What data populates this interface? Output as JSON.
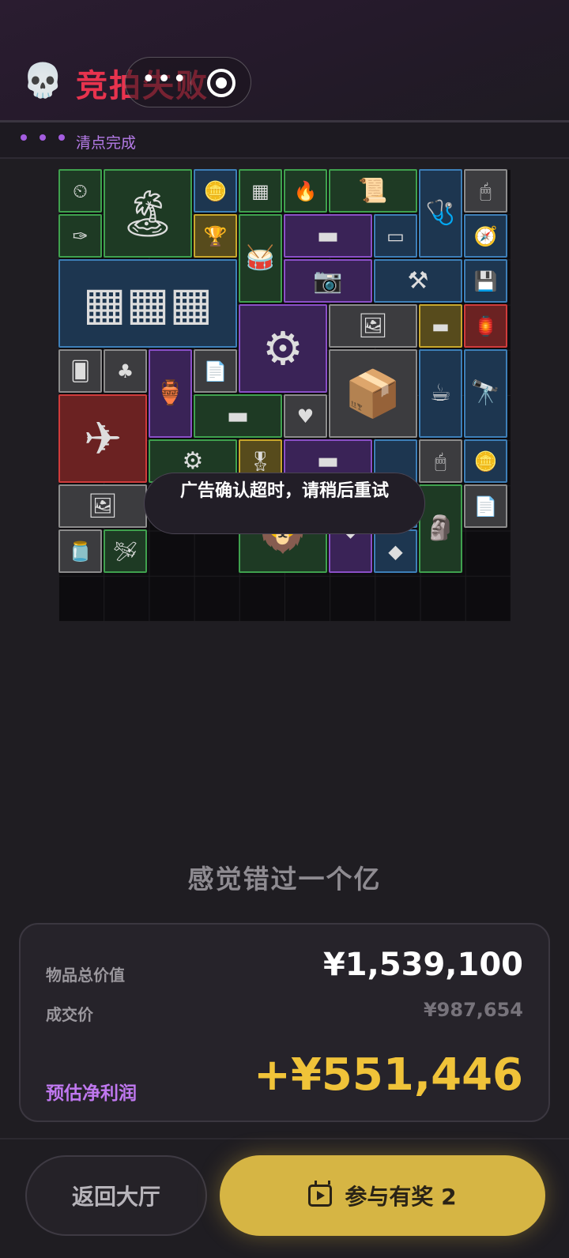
{
  "header": {
    "status_title": "竞拍失败",
    "skull_icon": "skull-icon",
    "menu_icon": "more-dots-icon",
    "close_icon": "target-circle-icon"
  },
  "progress": {
    "text": "清点完成"
  },
  "inventory": {
    "rarity_colors": {
      "green": "#3fa14e",
      "blue": "#3d7fb8",
      "purple": "#8a4fc7",
      "gold": "#c8a72c",
      "red": "#d03b3b",
      "gray": "#8c8c8c"
    },
    "items": [
      {
        "name": "gauge-icon",
        "rarity": "green"
      },
      {
        "name": "painting-icon",
        "rarity": "green"
      },
      {
        "name": "coin-icon",
        "rarity": "blue"
      },
      {
        "name": "circuit-board-icon",
        "rarity": "green"
      },
      {
        "name": "lighter-icon",
        "rarity": "green"
      },
      {
        "name": "document-icon",
        "rarity": "green"
      },
      {
        "name": "stethoscope-icon",
        "rarity": "blue"
      },
      {
        "name": "mouse-icon",
        "rarity": "gray"
      },
      {
        "name": "tweezers-icon",
        "rarity": "green"
      },
      {
        "name": "trophy-icon",
        "rarity": "gold"
      },
      {
        "name": "drum-icon",
        "rarity": "green"
      },
      {
        "name": "graphics-card-icon",
        "rarity": "purple"
      },
      {
        "name": "ssd-icon",
        "rarity": "blue"
      },
      {
        "name": "compass-icon",
        "rarity": "blue"
      },
      {
        "name": "solar-panel-icon",
        "rarity": "blue"
      },
      {
        "name": "camera-lens-icon",
        "rarity": "purple"
      },
      {
        "name": "rifle-icon",
        "rarity": "blue"
      },
      {
        "name": "card-reader-icon",
        "rarity": "blue"
      },
      {
        "name": "circular-saw-icon",
        "rarity": "purple"
      },
      {
        "name": "old-photo-icon",
        "rarity": "gray"
      },
      {
        "name": "ram-stick-icon",
        "rarity": "gold"
      },
      {
        "name": "lamp-icon",
        "rarity": "red"
      },
      {
        "name": "playing-card-icon",
        "rarity": "gray"
      },
      {
        "name": "playing-card-icon",
        "rarity": "gray"
      },
      {
        "name": "hookah-icon",
        "rarity": "purple"
      },
      {
        "name": "papers-icon",
        "rarity": "gray"
      },
      {
        "name": "candle-box-icon",
        "rarity": "gray"
      },
      {
        "name": "coffee-pot-icon",
        "rarity": "blue"
      },
      {
        "name": "telescope-icon",
        "rarity": "blue"
      },
      {
        "name": "drone-icon",
        "rarity": "red"
      },
      {
        "name": "wood-plank-icon",
        "rarity": "green"
      },
      {
        "name": "playing-card-icon",
        "rarity": "gray"
      },
      {
        "name": "metal-part-icon",
        "rarity": "green"
      },
      {
        "name": "medal-icon",
        "rarity": "gold"
      },
      {
        "name": "graphics-card-icon",
        "rarity": "purple"
      },
      {
        "name": "blue-item-icon",
        "rarity": "blue"
      },
      {
        "name": "mouse-icon",
        "rarity": "gray"
      },
      {
        "name": "coin-icon",
        "rarity": "blue"
      },
      {
        "name": "old-photo-icon",
        "rarity": "gray"
      },
      {
        "name": "statue-icon",
        "rarity": "green"
      },
      {
        "name": "papers-icon",
        "rarity": "gray"
      },
      {
        "name": "supplement-jar-icon",
        "rarity": "gray"
      },
      {
        "name": "model-plane-icon",
        "rarity": "green"
      },
      {
        "name": "sphinx-statue-icon",
        "rarity": "green"
      },
      {
        "name": "purple-item-icon",
        "rarity": "purple"
      },
      {
        "name": "blue-item-icon",
        "rarity": "blue"
      }
    ]
  },
  "toast": {
    "text": "广告确认超时，请稍后重试"
  },
  "subtitle": "感觉错过一个亿",
  "summary": {
    "total_label": "物品总价值",
    "total_value": "¥1,539,100",
    "deal_label": "成交价",
    "deal_value": "¥987,654",
    "profit_label": "预估净利润",
    "profit_value": "+¥551,446"
  },
  "buttons": {
    "back_label": "返回大厅",
    "reward_label": "参与有奖 2",
    "reward_icon": "video-calendar-icon"
  }
}
